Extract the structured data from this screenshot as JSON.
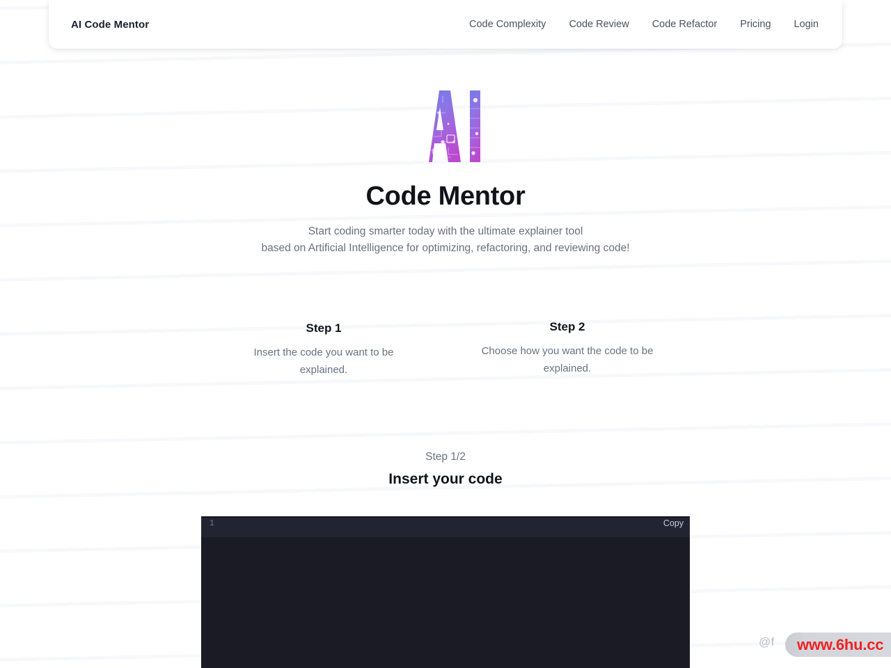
{
  "brand": {
    "name": "AI Code Mentor"
  },
  "nav": {
    "items": [
      {
        "label": "Code Complexity"
      },
      {
        "label": "Code Review"
      },
      {
        "label": "Code Refactor"
      },
      {
        "label": "Pricing"
      },
      {
        "label": "Login"
      }
    ]
  },
  "hero": {
    "logo_icon": "ai-letters-circuit-logo",
    "logo_text": "AI",
    "title": "Code Mentor",
    "subtitle_line1": "Start coding smarter today with the ultimate explainer tool",
    "subtitle_line2": "based on Artificial Intelligence for optimizing, refactoring, and reviewing code!"
  },
  "steps": [
    {
      "title": "Step 1",
      "description": "Insert the code you want to be explained."
    },
    {
      "title": "Step 2",
      "description": "Choose how you want the code to be explained."
    }
  ],
  "editor_section": {
    "step_counter": "Step 1/2",
    "title": "Insert your code"
  },
  "editor": {
    "line_numbers": "1",
    "copy_label": "Copy",
    "code_value": "",
    "placeholder": "",
    "colors": {
      "topbar_bg": "#222431",
      "body_bg": "#1b1b26",
      "line_number": "#6f7487",
      "copy_text": "#c9ccd6"
    }
  },
  "watermark": {
    "handle": "@f",
    "url": "www.6hu.cc",
    "url_color": "#ee2222"
  },
  "theme": {
    "page_bg": "#ffffff",
    "text_primary": "#0f131a",
    "text_muted": "#6b7180",
    "logo_gradient_from": "#7b7ce8",
    "logo_gradient_to": "#b34fd4"
  }
}
